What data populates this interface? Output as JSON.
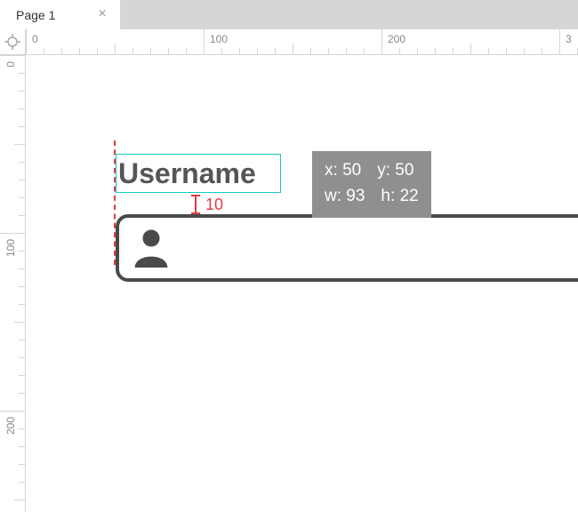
{
  "tab": {
    "title": "Page 1"
  },
  "ruler": {
    "h_labels": [
      "0",
      "100",
      "200",
      "3"
    ],
    "v_labels": [
      "0",
      "100",
      "200"
    ]
  },
  "selection": {
    "label": "Username",
    "spacing": "10"
  },
  "info": {
    "x_label": "x:",
    "x_value": "50",
    "y_label": "y:",
    "y_value": "50",
    "w_label": "w:",
    "w_value": "93",
    "h_label": "h:",
    "h_value": "22"
  }
}
